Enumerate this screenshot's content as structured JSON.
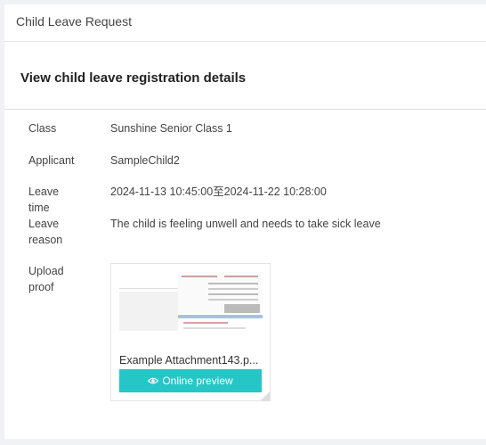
{
  "header": {
    "title": "Child Leave Request"
  },
  "page": {
    "heading": "View child leave registration details"
  },
  "details": {
    "class_label": "Class",
    "class_value": "Sunshine Senior Class 1",
    "applicant_label": "Applicant",
    "applicant_value": "SampleChild2",
    "leave_time_label": "Leave time",
    "leave_time_value": "2024-11-13 10:45:00至2024-11-22 10:28:00",
    "leave_reason_label_line1": "Leave",
    "leave_reason_label_line2": "reason",
    "leave_reason_value": "The child is feeling unwell and needs to take sick leave",
    "upload_label_line1": "Upload",
    "upload_label_line2": "proof"
  },
  "attachment": {
    "file_name": "Example Attachment143.p...",
    "preview_label": "Online preview",
    "preview_icon": "eye-icon",
    "button_color": "#26c6c6"
  }
}
